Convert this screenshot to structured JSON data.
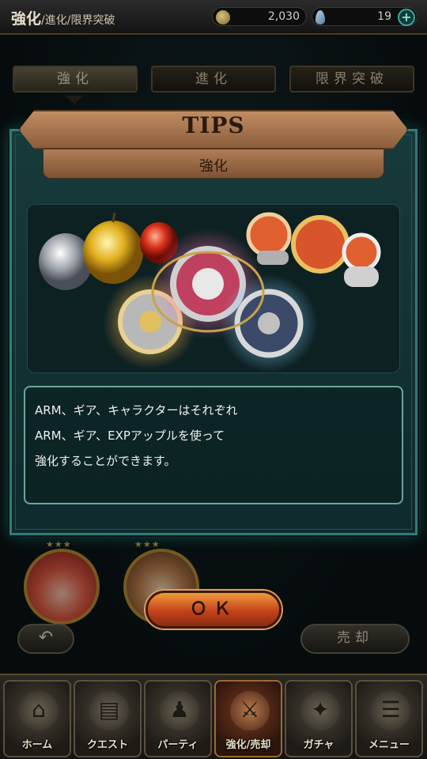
{
  "header": {
    "title": "強化",
    "breadcrumb_rest": "/進化/限界突破",
    "coins": "2,030",
    "gems": "19",
    "plus_label": "+"
  },
  "tabs": [
    {
      "label": "強化",
      "active": true
    },
    {
      "label": "進化",
      "active": false
    },
    {
      "label": "限界突破",
      "active": false
    }
  ],
  "modal": {
    "title": "TIPS",
    "subtitle": "強化",
    "lines": [
      "ARM、ギア、キャラクターはそれぞれ",
      "ARM、ギア、EXPアップルを使って",
      "強化することができます。"
    ],
    "ok_label": "ＯＫ"
  },
  "party": {
    "stars1": "★★★",
    "stars2": "★★★"
  },
  "actions": {
    "back_symbol": "↶",
    "sell_label": "売却"
  },
  "nav": [
    {
      "label": "ホーム",
      "icon": "home-icon",
      "glyph": "⌂"
    },
    {
      "label": "クエスト",
      "icon": "quest-book-icon",
      "glyph": "▤"
    },
    {
      "label": "パーティ",
      "icon": "party-icon",
      "glyph": "♟"
    },
    {
      "label": "強化/売却",
      "icon": "enhance-icon",
      "glyph": "⚔"
    },
    {
      "label": "ガチャ",
      "icon": "gacha-icon",
      "glyph": "✦"
    },
    {
      "label": "メニュー",
      "icon": "menu-icon",
      "glyph": "☰"
    }
  ],
  "colors": {
    "accent_teal": "#2f7c78",
    "banner_brown": "#a9764f",
    "ok_orange": "#d8622a"
  }
}
